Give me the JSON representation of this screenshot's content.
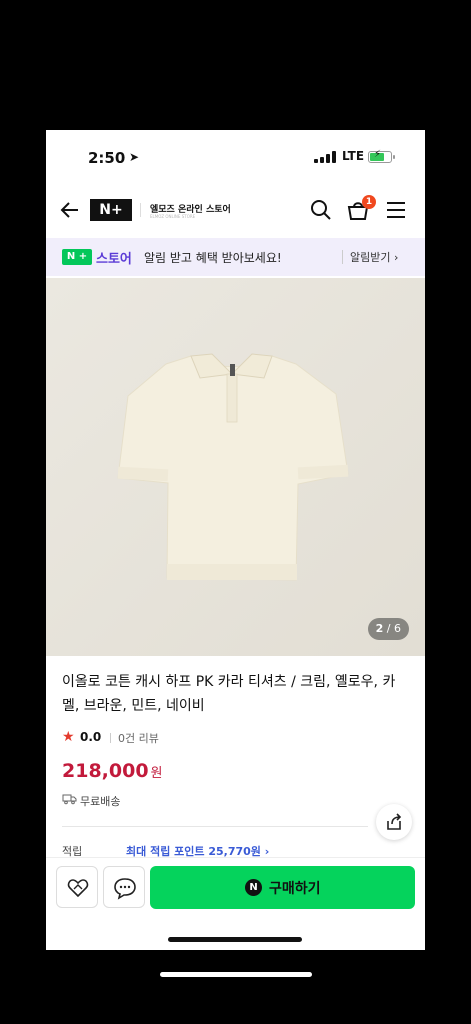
{
  "status": {
    "time": "2:50",
    "network": "LTE"
  },
  "header": {
    "logo": "N+",
    "store_name": "엘모즈 온라인 스토어",
    "store_sub": "ELMOZ ONLINE STORE",
    "cart_count": "1"
  },
  "banner": {
    "brand": "스토어",
    "message": "알림 받고 혜택 받아보세요!",
    "cta": "알림받기 ›"
  },
  "gallery": {
    "current": "2",
    "separator": " / ",
    "total": "6"
  },
  "product": {
    "title": "이올로 코튼 캐시 하프 PK 카라 티셔츠 / 크림, 옐로우, 카멜, 브라운, 민트, 네이비",
    "rating": "0.0",
    "reviews": "0건 리뷰",
    "price": "218,000",
    "price_unit": "원",
    "shipping": "무료배송",
    "points_label": "적립",
    "points": "최대 적립 포인트 25,770원 ›"
  },
  "actions": {
    "buy_label": "구매하기",
    "buy_icon": "N"
  },
  "colors": {
    "naver_green": "#03c75a",
    "price_red": "#c21a3b",
    "accent_purple": "#5b3bd6",
    "points_blue": "#3a5bd6"
  }
}
